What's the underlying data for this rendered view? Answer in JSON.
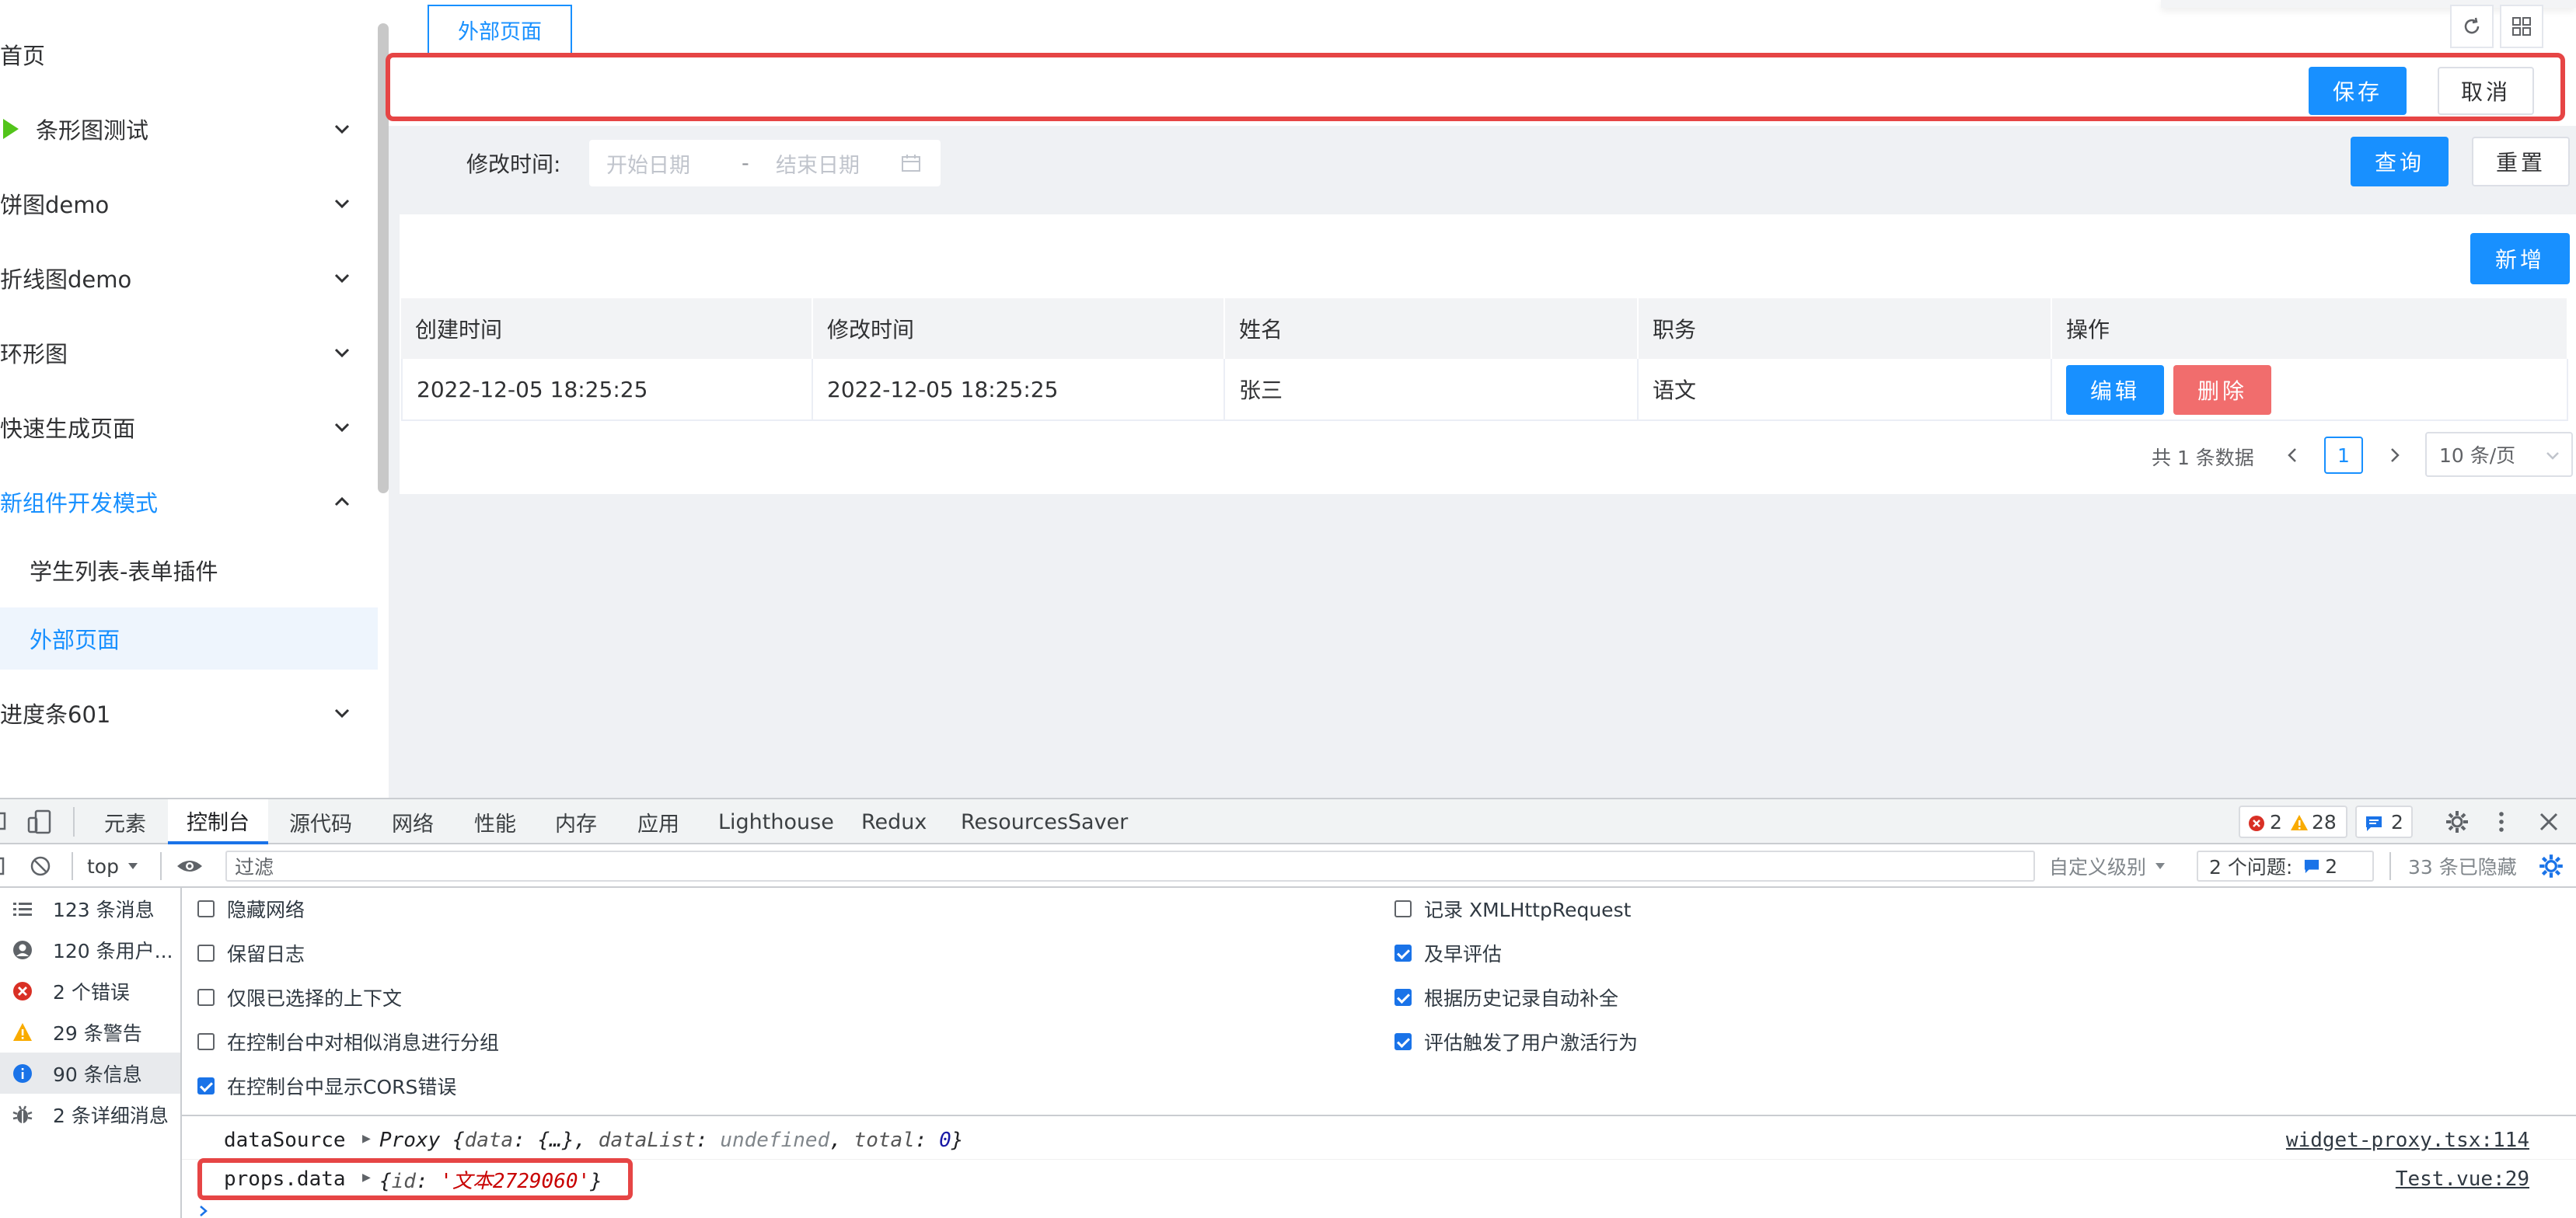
{
  "sidebar": {
    "items": [
      {
        "label": "首页"
      },
      {
        "label": "条形图测试"
      },
      {
        "label": "饼图demo"
      },
      {
        "label": "折线图demo"
      },
      {
        "label": "环形图"
      },
      {
        "label": "快速生成页面"
      },
      {
        "label": "新组件开发模式"
      },
      {
        "label": "学生列表-表单插件"
      },
      {
        "label": "外部页面"
      },
      {
        "label": "进度条601"
      }
    ],
    "accent": "#1890ff"
  },
  "tabs": {
    "active_label": "外部页面"
  },
  "toolbar": {
    "save_label": "保存",
    "cancel_label": "取消"
  },
  "search": {
    "label": "修改时间:",
    "start_placeholder": "开始日期",
    "separator": "-",
    "end_placeholder": "结束日期",
    "query_label": "查询",
    "reset_label": "重置"
  },
  "table": {
    "add_label": "新增",
    "columns": [
      "创建时间",
      "修改时间",
      "姓名",
      "职务",
      "操作"
    ],
    "rows": [
      {
        "created": "2022-12-05 18:25:25",
        "modified": "2022-12-05 18:25:25",
        "name": "张三",
        "job": "语文",
        "edit": "编辑",
        "delete": "删除"
      }
    ]
  },
  "pagination": {
    "total_text": "共 1 条数据",
    "current": "1",
    "page_size": "10 条/页"
  },
  "devtools": {
    "tabs": [
      "元素",
      "控制台",
      "源代码",
      "网络",
      "性能",
      "内存",
      "应用",
      "Lighthouse",
      "Redux",
      "ResourcesSaver"
    ],
    "active_tab": "控制台",
    "error_count": "2",
    "warning_count": "28",
    "info_count": "2",
    "context": "top",
    "filter_placeholder": "过滤",
    "level_label": "自定义级别",
    "issues_label": "2 个问题:",
    "issues_count": "2",
    "hidden_label": "33 条已隐藏",
    "side": [
      {
        "label": "123 条消息",
        "icon": "list-icon"
      },
      {
        "label": "120 条用户...",
        "icon": "user-icon"
      },
      {
        "label": "2 个错误",
        "icon": "error-icon"
      },
      {
        "label": "29 条警告",
        "icon": "warning-icon"
      },
      {
        "label": "90 条信息",
        "icon": "info-icon"
      },
      {
        "label": "2 条详细消息",
        "icon": "bug-icon"
      }
    ],
    "settings_left": [
      {
        "label": "隐藏网络",
        "checked": false
      },
      {
        "label": "保留日志",
        "checked": false
      },
      {
        "label": "仅限已选择的上下文",
        "checked": false
      },
      {
        "label": "在控制台中对相似消息进行分组",
        "checked": false
      },
      {
        "label": "在控制台中显示CORS错误",
        "checked": true
      }
    ],
    "settings_right": [
      {
        "label": "记录 XMLHttpRequest",
        "checked": false
      },
      {
        "label": "及早评估",
        "checked": true
      },
      {
        "label": "根据历史记录自动补全",
        "checked": true
      },
      {
        "label": "评估触发了用户激活行为",
        "checked": true
      }
    ],
    "logs": [
      {
        "name": "dataSource",
        "prefix": "Proxy {",
        "k1": "data",
        "v1": "{…}",
        "k2": "dataList",
        "v2": "undefined",
        "k3": "total",
        "v3": "0",
        "suffix": "}",
        "source": "widget-proxy.tsx:114"
      },
      {
        "name": "props.data",
        "prefix": "{",
        "k1": "id",
        "v1": "'文本2729060'",
        "suffix": "}",
        "source": "Test.vue:29"
      }
    ]
  }
}
